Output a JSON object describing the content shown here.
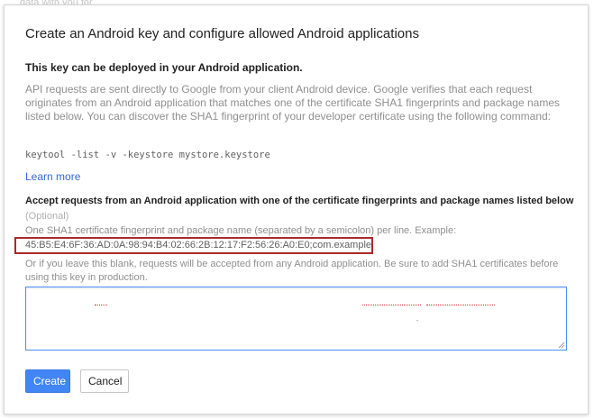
{
  "backdrop": {
    "partial_text": "data with you for"
  },
  "dialog": {
    "title": "Create an Android key and configure allowed Android applications",
    "section_heading": "This key can be deployed in your Android application.",
    "description": "API requests are sent directly to Google from your client Android device. Google verifies that each request originates from an Android application that matches one of the certificate SHA1 fingerprints and package names listed below. You can discover the SHA1 fingerprint of your developer certificate using the following command:",
    "command": "keytool -list -v -keystore mystore.keystore",
    "learn_more": "Learn more",
    "accept_heading": "Accept requests from an Android application with one of the certificate fingerprints and package names listed below",
    "optional": "(Optional)",
    "hint": "One SHA1 certificate fingerprint and package name (separated by a semicolon) per line. Example:",
    "example": "45:B5:E4:6F:36:AD:0A:98:94:B4:02:66:2B:12:17:F2:56:26:A0:E0;com.example",
    "blank_note": "Or if you leave this blank, requests will be accepted from any Android application. Be sure to add SHA1 certificates before using this key in production.",
    "textarea_value": ""
  },
  "buttons": {
    "create": "Create",
    "cancel": "Cancel"
  },
  "colors": {
    "primary_button": "#4285f4",
    "link": "#3367d6",
    "highlight_box": "#a82a2a",
    "focus_border": "#4d90fe"
  }
}
